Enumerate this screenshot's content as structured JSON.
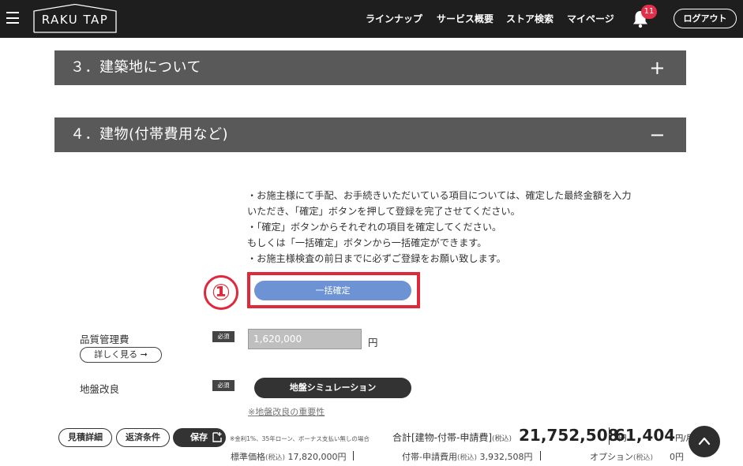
{
  "header": {
    "logo_text": "RAKU TAP",
    "nav": [
      "ラインナップ",
      "サービス概要",
      "ストア検索",
      "マイページ"
    ],
    "notification_count": "11",
    "logout_label": "ログアウト"
  },
  "sections": [
    {
      "title": "３．建築地について",
      "toggle": "+"
    },
    {
      "title": "４．建物(付帯費用など)",
      "toggle": "−"
    }
  ],
  "notes": [
    "・お施主様にて手配、お手続きいただいている項目については、確定した最終金額を入力",
    "いただき、「確定」ボタンを押して登録を完了させてください。",
    "・「確定」ボタンからそれぞれの項目を確定してください。",
    "もしくは「一括確定」ボタンから一括確定ができます。",
    "・お施主様検査の前日までに必ずご登録をお願い致します。"
  ],
  "annotation_number": "①",
  "bulk_confirm_label": "一括確定",
  "items": [
    {
      "label": "品質管理費",
      "required": "必須",
      "value": "1,620,000",
      "unit": "円",
      "detail_label": "詳しく見る ➞"
    },
    {
      "label": "地盤改良",
      "required": "必須",
      "action_label": "地盤シミュレーション",
      "link": "※地盤改良の重要性"
    }
  ],
  "bottom": {
    "estimate_label": "見積詳細",
    "repayment_label": "返済条件",
    "save_label": "保存",
    "note": "※金利1%、35年ローン、ボーナス支払い無しの場合",
    "total_label": "合計[建物-付帯-申請費]",
    "tax_incl": "(税込)",
    "total_value": "21,752,508",
    "yen": "円",
    "monthly_value": "61,404",
    "per_month": "円/月",
    "standard_label": "標準価格",
    "standard_value": "17,820,000円",
    "incidental_label": "付帯-申請費用",
    "incidental_value": "3,932,508円",
    "option_label": "オプション",
    "option_value": "0円"
  }
}
